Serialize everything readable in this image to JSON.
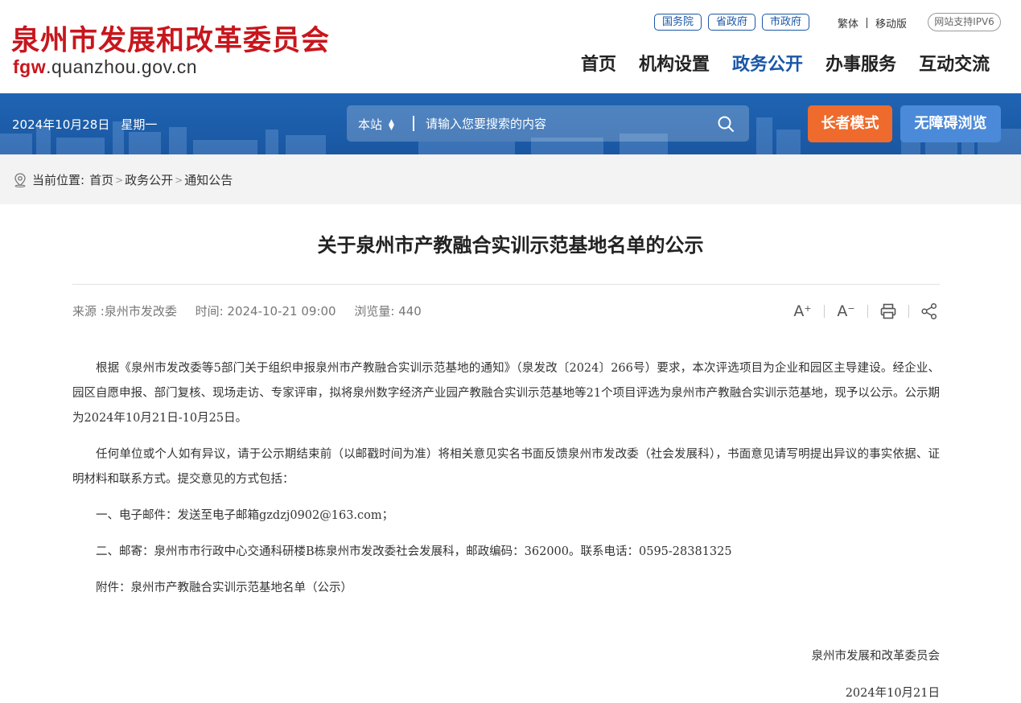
{
  "header": {
    "site_title": "泉州市发展和改革委员会",
    "site_url_prefix": "fgw",
    "site_url_rest": ".quanzhou.gov.cn",
    "top_links": [
      "国务院",
      "省政府",
      "市政府"
    ],
    "lang_traditional": "繁体",
    "mobile_version": "移动版",
    "ipv6_badge": "网站支持IPV6",
    "nav": [
      "首页",
      "机构设置",
      "政务公开",
      "办事服务",
      "互动交流"
    ],
    "active_nav": "政务公开"
  },
  "bar": {
    "date": "2024年10月28日",
    "weekday": "星期一",
    "search_scope": "本站",
    "search_placeholder": "请输入您要搜索的内容",
    "elder_mode": "长者模式",
    "accessible_browse": "无障碍浏览"
  },
  "breadcrumb": {
    "label": "当前位置:",
    "items": [
      "首页",
      "政务公开",
      "通知公告"
    ]
  },
  "article": {
    "title": "关于泉州市产教融合实训示范基地名单的公示",
    "source": "来源 :泉州市发改委",
    "time": "时间:  2024-10-21 09:00",
    "views": "浏览量:  440",
    "paragraphs": [
      "根据《泉州市发改委等5部门关于组织申报泉州市产教融合实训示范基地的通知》（泉发改〔2024〕266号）要求，本次评选项目为企业和园区主导建设。经企业、园区自愿申报、部门复核、现场走访、专家评审，拟将泉州数字经济产业园产教融合实训示范基地等21个项目评选为泉州市产教融合实训示范基地，现予以公示。公示期为2024年10月21日-10月25日。",
      "任何单位或个人如有异议，请于公示期结束前（以邮戳时间为准）将相关意见实名书面反馈泉州市发改委（社会发展科），书面意见请写明提出异议的事实依据、证明材料和联系方式。提交意见的方式包括：",
      "一、电子邮件：发送至电子邮箱gzdzj0902@163.com；",
      "二、邮寄：泉州市市行政中心交通科研楼B栋泉州市发改委社会发展科，邮政编码：362000。联系电话：0595-28381325",
      "附件：泉州市产教融合实训示范基地名单（公示）"
    ],
    "signature_org": "泉州市发展和改革委员会",
    "signature_date": "2024年10月21日"
  },
  "colors": {
    "brand_red": "#c8161d",
    "brand_blue": "#1a56a7",
    "elder_orange": "#ee6b2d"
  }
}
